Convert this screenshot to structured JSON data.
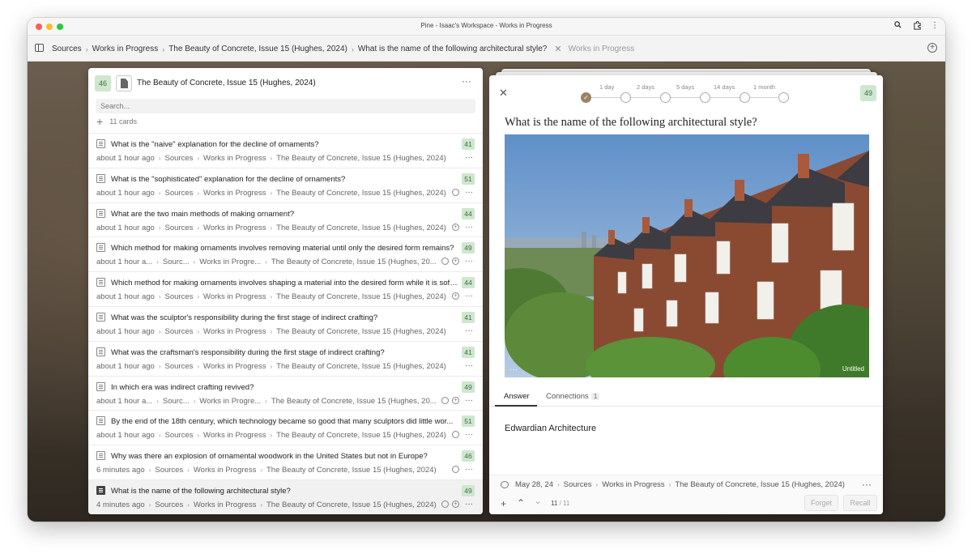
{
  "window": {
    "title": "Pine - Isaac's Workspace - Works in Progress"
  },
  "toolbar": {
    "breadcrumbs": [
      "Sources",
      "Works in Progress",
      "The Beauty of Concrete, Issue 15 (Hughes, 2024)",
      "What is the name of the following architectural style?"
    ],
    "inactive_tab": "Works in Progress"
  },
  "left_panel": {
    "count": "46",
    "title": "The Beauty of Concrete, Issue 15 (Hughes, 2024)",
    "search_placeholder": "Search...",
    "cards_count": "11 cards",
    "cards": [
      {
        "question": "What is the \"naive\" explanation for the decline of ornaments?",
        "score": "41",
        "time": "about 1 hour ago",
        "path": [
          "Sources",
          "Works in Progress",
          "The Beauty of Concrete, Issue 15 (Hughes, 2024)"
        ],
        "icons": []
      },
      {
        "question": "What is the \"sophisticated\" explanation for the decline of ornaments?",
        "score": "51",
        "time": "about 1 hour ago",
        "path": [
          "Sources",
          "Works in Progress",
          "The Beauty of Concrete, Issue 15 (Hughes, 2024)"
        ],
        "icons": [
          "comment"
        ]
      },
      {
        "question": "What are the two main methods of making ornament?",
        "score": "44",
        "time": "about 1 hour ago",
        "path": [
          "Sources",
          "Works in Progress",
          "The Beauty of Concrete, Issue 15 (Hughes, 2024)"
        ],
        "icons": [
          "plus"
        ]
      },
      {
        "question": "Which method for making ornaments involves removing material until only the desired form remains?",
        "score": "49",
        "time": "about 1 hour a...",
        "path": [
          "Sourc...",
          "Works in Progre...",
          "The Beauty of Concrete, Issue 15 (Hughes, 20..."
        ],
        "icons": [
          "comment",
          "plus"
        ]
      },
      {
        "question": "Which method for making ornaments involves shaping a material into the desired form while it is soft...",
        "score": "44",
        "time": "about 1 hour ago",
        "path": [
          "Sources",
          "Works in Progress",
          "The Beauty of Concrete, Issue 15 (Hughes, 2024)"
        ],
        "icons": [
          "plus"
        ]
      },
      {
        "question": "What was the sculptor's responsibility during the first stage of indirect crafting?",
        "score": "41",
        "time": "about 1 hour ago",
        "path": [
          "Sources",
          "Works in Progress",
          "The Beauty of Concrete, Issue 15 (Hughes, 2024)"
        ],
        "icons": []
      },
      {
        "question": "What was the craftsman's responsibility during the first stage of indirect crafting?",
        "score": "41",
        "time": "about 1 hour ago",
        "path": [
          "Sources",
          "Works in Progress",
          "The Beauty of Concrete, Issue 15 (Hughes, 2024)"
        ],
        "icons": []
      },
      {
        "question": "In which era was indirect crafting revived?",
        "score": "49",
        "time": "about 1 hour a...",
        "path": [
          "Sourc...",
          "Works in Progre...",
          "The Beauty of Concrete, Issue 15 (Hughes, 20..."
        ],
        "icons": [
          "comment",
          "plus"
        ]
      },
      {
        "question": "By the end of the 18th century, which technology became so good that many sculptors did little wor...",
        "score": "51",
        "time": "about 1 hour ago",
        "path": [
          "Sources",
          "Works in Progress",
          "The Beauty of Concrete, Issue 15 (Hughes, 2024)"
        ],
        "icons": [
          "comment"
        ]
      },
      {
        "question": "Why was there an explosion of ornamental woodwork in the United States but not in Europe?",
        "score": "46",
        "time": "6 minutes ago",
        "path": [
          "Sources",
          "Works in Progress",
          "The Beauty of Concrete, Issue 15 (Hughes, 2024)"
        ],
        "icons": [
          "comment"
        ]
      },
      {
        "question": "What is the name of the following architectural style?",
        "score": "49",
        "time": "4 minutes ago",
        "path": [
          "Sources",
          "Works in Progress",
          "The Beauty of Concrete, Issue 15 (Hughes, 2024)"
        ],
        "icons": [
          "comment",
          "plus"
        ],
        "active": true
      }
    ]
  },
  "right_panel": {
    "intervals": [
      "1 day",
      "2 days",
      "5 days",
      "14 days",
      "1 month"
    ],
    "score": "49",
    "question": "What is the name of the following architectural style?",
    "image_caption": "Untitled",
    "tabs": {
      "answer": "Answer",
      "connections": "Connections",
      "connections_count": "1"
    },
    "answer": "Edwardian Architecture",
    "footer": {
      "date": "May 28, 24",
      "path": [
        "Sources",
        "Works in Progress",
        "The Beauty of Concrete, Issue 15 (Hughes, 2024)"
      ],
      "pager_current": "11",
      "pager_total": "/ 11",
      "forget_label": "Forget",
      "recall_label": "Recall"
    }
  },
  "colors": {
    "score_bg": "#cfe6cf",
    "score_text": "#3d6e3d",
    "interval_done": "#9a8464"
  }
}
